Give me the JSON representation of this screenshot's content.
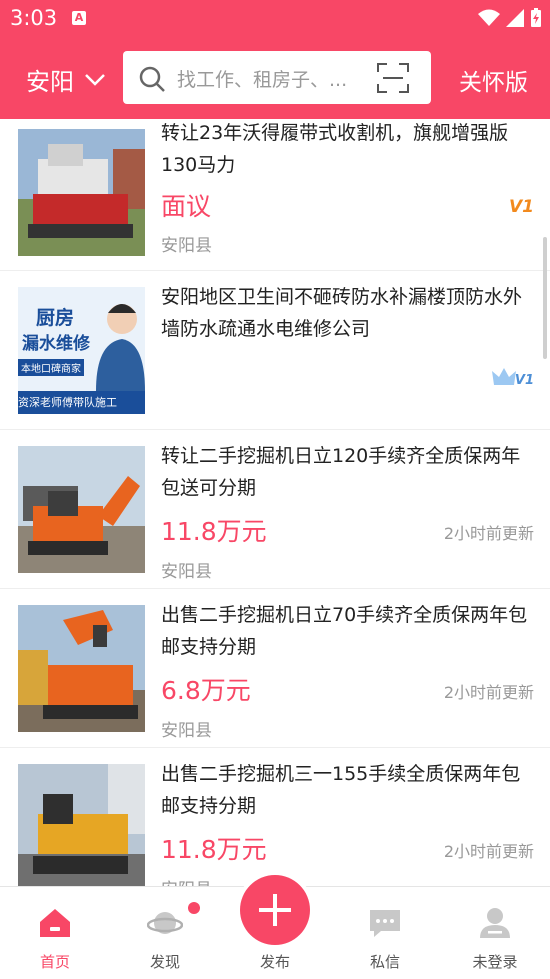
{
  "status_bar": {
    "time": "3:03",
    "notif_letter": "A"
  },
  "header": {
    "city": "安阳",
    "search_placeholder": "找工作、租房子、...",
    "care_mode": "关怀版"
  },
  "listings": [
    {
      "title": "转让23年沃得履带式收割机，旗舰增强版130马力",
      "price": "面议",
      "location": "安阳县",
      "updated": "",
      "badge": "V1"
    },
    {
      "title": "安阳地区卫生间不砸砖防水补漏楼顶防水外墙防水疏通水电维修公司",
      "price": "",
      "location": "",
      "updated": "",
      "badge": "V1",
      "thumb_text": [
        "厨房",
        "漏水维修",
        "本地口碑商家",
        "资深老师傅带队施工"
      ]
    },
    {
      "title": "转让二手挖掘机日立120手续齐全质保两年包送可分期",
      "price": "11.8万元",
      "location": "安阳县",
      "updated": "2小时前更新"
    },
    {
      "title": "出售二手挖掘机日立70手续齐全质保两年包邮支持分期",
      "price": "6.8万元",
      "location": "安阳县",
      "updated": "2小时前更新"
    },
    {
      "title": "出售二手挖掘机三一155手续全质保两年包邮支持分期",
      "price": "11.8万元",
      "location": "安阳县",
      "updated": "2小时前更新"
    }
  ],
  "bottom_nav": [
    {
      "label": "首页",
      "active": true
    },
    {
      "label": "发现",
      "active": false
    },
    {
      "label": "发布",
      "active": false
    },
    {
      "label": "私信",
      "active": false
    },
    {
      "label": "未登录",
      "active": false
    }
  ],
  "colors": {
    "brand": "#f84766",
    "text": "#222222",
    "muted": "#999999"
  }
}
